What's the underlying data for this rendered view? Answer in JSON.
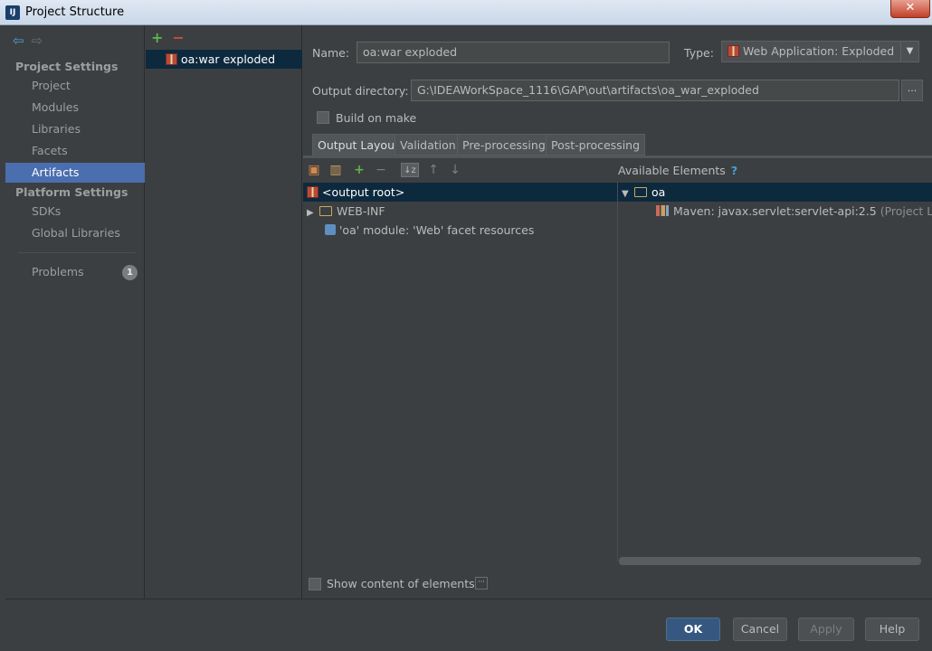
{
  "window": {
    "title": "Project Structure",
    "close_glyph": "✕"
  },
  "sidebar": {
    "back_glyph": "⇦",
    "forward_glyph": "⇨",
    "project_settings_header": "Project Settings",
    "project_settings_items": [
      {
        "label": "Project"
      },
      {
        "label": "Modules"
      },
      {
        "label": "Libraries"
      },
      {
        "label": "Facets"
      },
      {
        "label": "Artifacts",
        "selected": true
      }
    ],
    "platform_settings_header": "Platform Settings",
    "platform_settings_items": [
      {
        "label": "SDKs"
      },
      {
        "label": "Global Libraries"
      }
    ],
    "problems_label": "Problems",
    "problems_count": "1"
  },
  "artifacts": {
    "add_glyph": "+",
    "remove_glyph": "−",
    "items": [
      {
        "label": "oa:war exploded"
      }
    ]
  },
  "form": {
    "name_label": "Name:",
    "name_value": "oa:war exploded",
    "type_label": "Type:",
    "type_value": "Web Application: Exploded",
    "output_dir_label": "Output directory:",
    "output_dir_value": "G:\\IDEAWorkSpace_1116\\GAP\\out\\artifacts\\oa_war_exploded",
    "browse_glyph": "...",
    "build_on_make_label": "Build on make"
  },
  "tabs": [
    {
      "label": "Output Layout",
      "active": true
    },
    {
      "label": "Validation"
    },
    {
      "label": "Pre-processing"
    },
    {
      "label": "Post-processing"
    }
  ],
  "layout_tree": {
    "root_label": "<output root>",
    "items": [
      {
        "label": "WEB-INF",
        "expander": "▶"
      },
      {
        "label": "'oa' module: 'Web' facet resources"
      }
    ]
  },
  "available": {
    "header": "Available Elements",
    "help_glyph": "?",
    "root_label": "oa",
    "root_expander": "▼",
    "library_label": "Maven: javax.servlet:servlet-api:2.5",
    "library_suffix": "(Project Library)"
  },
  "show_content_label": "Show content of elements",
  "buttons": {
    "ok": "OK",
    "cancel": "Cancel",
    "apply": "Apply",
    "help": "Help"
  },
  "colors": {
    "background": "#3c3f41",
    "selection": "#4b6eaf",
    "tree_selection": "#0d293e",
    "primary_button": "#365880"
  }
}
